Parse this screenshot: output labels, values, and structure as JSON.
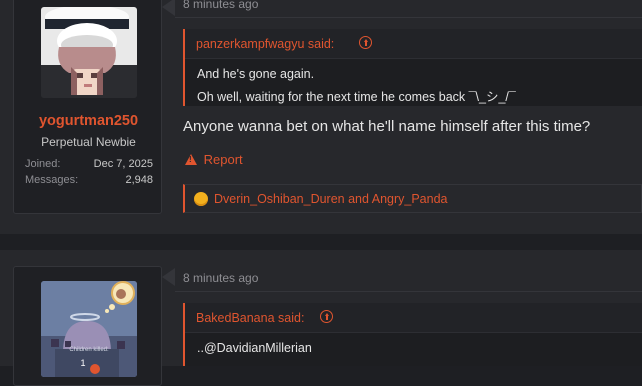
{
  "posts": [
    {
      "time": "8 minutes ago",
      "author": {
        "name": "yogurtman250",
        "title": "Perpetual Newbie",
        "stats": [
          {
            "label": "Joined:",
            "value": "Dec 7, 2025"
          },
          {
            "label": "Messages:",
            "value": "2,948"
          }
        ]
      },
      "quote": {
        "author_label": "panzerkampfwagyu said:",
        "lines": [
          "And he's gone again.",
          "Oh well, waiting for the next time he comes back ¯\\_シ_/¯"
        ]
      },
      "message": "Anyone wanna bet on what he'll name himself after this time?",
      "report_label": "Report",
      "reactions_text": "Dverin_Oshiban_Duren and Angry_Panda"
    },
    {
      "time": "8 minutes ago",
      "author": {
        "avatar_caption": "Children killed:",
        "avatar_count": "1"
      },
      "quote": {
        "author_label": "BakedBanana said:",
        "lines": [
          "..@DavidianMillerian"
        ]
      }
    }
  ],
  "colors": {
    "accent": "#e0552f",
    "background": "#1e1f23",
    "post_background": "#27282c",
    "user_cell": "#1f2024",
    "reaction": "#f2b01e"
  },
  "icons": [
    "report-warning-icon",
    "quote-jump-icon",
    "reaction-laugh-icon"
  ]
}
